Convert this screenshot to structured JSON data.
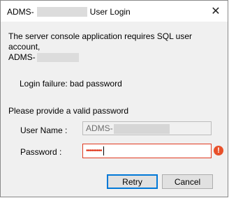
{
  "window": {
    "title_prefix": "ADMS-",
    "title_suffix": "User Login",
    "close_glyph": "✕"
  },
  "message": {
    "line1": "The server console application requires SQL user account,",
    "line2_prefix": "ADMS-"
  },
  "status": {
    "failure_text": "Login failure: bad password"
  },
  "form": {
    "prompt": "Please provide a valid password",
    "user_name_label": "User Name :",
    "user_name_value_prefix": "ADMS-",
    "password_label": "Password :",
    "password_mask": "•••••••••",
    "error_glyph": "!"
  },
  "buttons": {
    "retry": "Retry",
    "cancel": "Cancel"
  },
  "colors": {
    "error": "#e0391f",
    "focus": "#0078d7"
  }
}
